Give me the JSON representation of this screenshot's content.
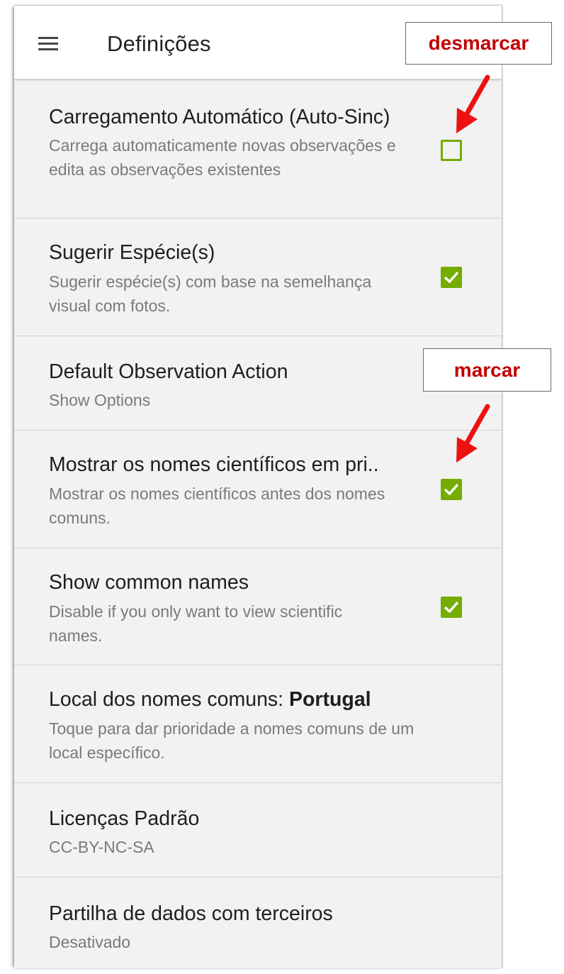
{
  "appbar": {
    "title": "Definições",
    "menu_icon": "hamburger-menu-icon"
  },
  "settings": [
    {
      "title": "Carregamento Automático (Auto-Sinc)",
      "subtitle": "Carrega automaticamente novas observações e edita as observações existentes",
      "checked": false
    },
    {
      "title": "Sugerir Espécie(s)",
      "subtitle": "Sugerir espécie(s) com base na semelhança visual com fotos.",
      "checked": true
    },
    {
      "title": "Default Observation Action",
      "subtitle": "Show Options"
    },
    {
      "title": "Mostrar os nomes científicos em pri..",
      "subtitle": "Mostrar os nomes científicos antes dos nomes comuns.",
      "checked": true
    },
    {
      "title": "Show common names",
      "subtitle": "Disable if you only want to view scientific names.",
      "checked": true
    },
    {
      "title_prefix": "Local dos nomes comuns: ",
      "title_value": "Portugal",
      "subtitle": "Toque para dar prioridade a nomes comuns de um local específico."
    },
    {
      "title": "Licenças Padrão",
      "subtitle": "CC-BY-NC-SA"
    },
    {
      "title": "Partilha de dados com terceiros",
      "subtitle": "Desativado"
    }
  ],
  "annotations": {
    "uncheck_label": "desmarcar",
    "check_label": "marcar",
    "color": "#c00000"
  },
  "colors": {
    "accent": "#74ac00",
    "background": "#f2f2f2",
    "appbar": "#ffffff"
  }
}
